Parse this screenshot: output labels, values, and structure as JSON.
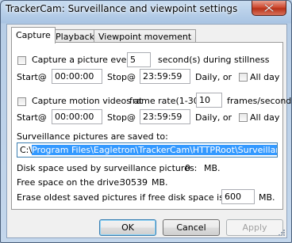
{
  "window": {
    "title": "TrackerCam: Surveillance and viewpoint settings"
  },
  "tabs": [
    {
      "label": "Capture"
    },
    {
      "label": "Playback"
    },
    {
      "label": "Viewpoint movement"
    }
  ],
  "capture": {
    "picture_label": "Capture a picture every",
    "picture_interval": "5",
    "picture_suffix": "second(s) during stillness",
    "start_label": "Start@",
    "stop_label": "Stop@",
    "daily_label": "Daily, or",
    "allday_label": "All day",
    "picture_start": "00:00:00",
    "picture_stop": "23:59:59",
    "video_label": "Capture motion videos at",
    "frame_rate_label": "frame rate(1-30):",
    "frame_rate": "10",
    "frame_rate_suffix": "frames/second",
    "video_start": "00:00:00",
    "video_stop": "23:59:59"
  },
  "storage": {
    "saved_to_label": "Surveillance pictures are saved to:",
    "path_drive": "C:\\",
    "path_selected": "Program Files\\Eagletron\\TrackerCam\\HTTPRoot\\Surveillance\\",
    "disk_used_label": "Disk space used by surveillance pictures:",
    "disk_used_value": "0",
    "disk_used_unit": "MB.",
    "free_space_label": "Free space on the drive:",
    "free_space_value": "30539",
    "free_space_unit": "MB.",
    "erase_label": "Erase oldest saved pictures if free disk space is below",
    "erase_threshold": "600",
    "erase_unit": "MB."
  },
  "buttons": {
    "ok": "OK",
    "cancel": "Cancel",
    "apply": "Apply"
  }
}
